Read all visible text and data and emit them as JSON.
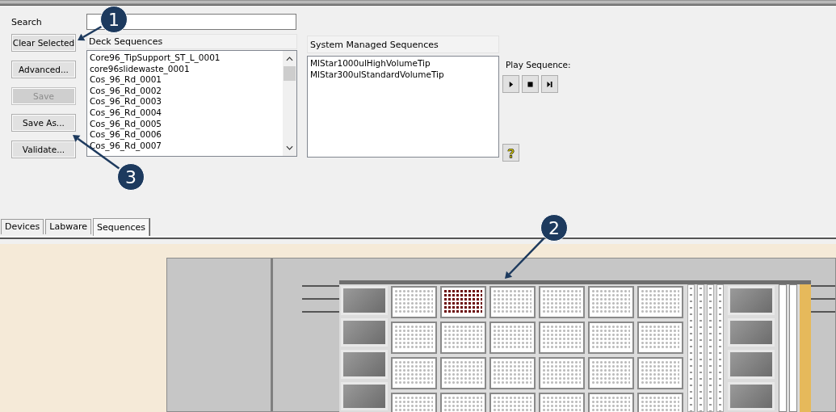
{
  "search": {
    "label": "Search"
  },
  "buttons": [
    {
      "label": "Clear Selected",
      "disabled": false
    },
    {
      "label": "Advanced...",
      "disabled": false
    },
    {
      "label": "Save",
      "disabled": true
    },
    {
      "label": "Save As...",
      "disabled": false
    },
    {
      "label": "Validate...",
      "disabled": false
    }
  ],
  "deck_sequences": {
    "title": "Deck Sequences",
    "items": [
      "Core96_TipSupport_ST_L_0001",
      "core96slidewaste_0001",
      "Cos_96_Rd_0001",
      "Cos_96_Rd_0002",
      "Cos_96_Rd_0003",
      "Cos_96_Rd_0004",
      "Cos_96_Rd_0005",
      "Cos_96_Rd_0006",
      "Cos_96_Rd_0007"
    ]
  },
  "system_sequences": {
    "title": "System Managed Sequences",
    "items": [
      "MlStar1000ulHighVolumeTip",
      "MlStar300ulStandardVolumeTip"
    ]
  },
  "play_sequence": {
    "label": "Play Sequence:"
  },
  "tabs": [
    {
      "label": "Devices",
      "selected": false
    },
    {
      "label": "Labware",
      "selected": false
    },
    {
      "label": "Sequences",
      "selected": true
    }
  ],
  "deck": {
    "rows": [
      {
        "plates": [
          {
            "selected": false
          },
          {
            "selected": true
          },
          {
            "selected": false
          },
          {
            "selected": false
          },
          {
            "selected": false
          },
          {
            "selected": false
          }
        ]
      },
      {
        "plates": [
          {
            "selected": false
          },
          {
            "selected": false
          },
          {
            "selected": false
          },
          {
            "selected": false
          },
          {
            "selected": false
          },
          {
            "selected": false
          }
        ]
      },
      {
        "plates": [
          {
            "selected": false
          },
          {
            "selected": false
          },
          {
            "selected": false
          },
          {
            "selected": false
          },
          {
            "selected": false
          },
          {
            "selected": false
          }
        ]
      },
      {
        "plates": [
          {
            "selected": false
          },
          {
            "selected": false
          },
          {
            "selected": false
          },
          {
            "selected": false
          },
          {
            "selected": false
          },
          {
            "selected": false
          }
        ]
      }
    ]
  },
  "callouts": [
    {
      "number": "1"
    },
    {
      "number": "2"
    },
    {
      "number": "3"
    }
  ]
}
